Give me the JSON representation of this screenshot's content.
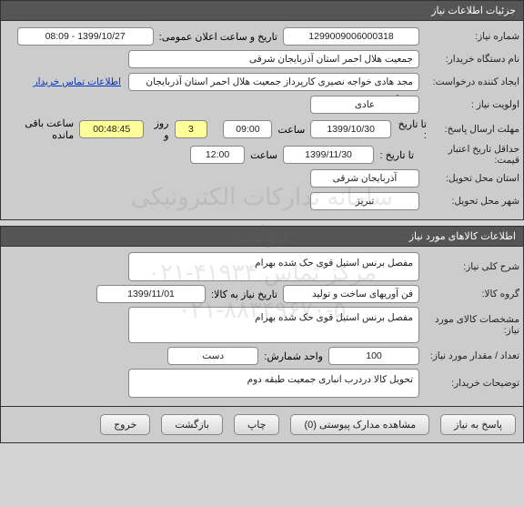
{
  "sections": {
    "need_info_header": "جزئیات اطلاعات نیاز",
    "goods_info_header": "اطلاعات کالاهای مورد نیاز"
  },
  "need": {
    "number_label": "شماره نیاز:",
    "number": "1299009006000318",
    "announce_label": "تاریخ و ساعت اعلان عمومی:",
    "announce_value": "1399/10/27 - 08:09",
    "buyer_label": "نام دستگاه خریدار:",
    "buyer": "جمعیت هلال احمر استان آذربایجان شرقی",
    "creator_label": "ایجاد کننده درخواست:",
    "creator": "مجد هادی خواجه نصیری کارپرداز جمعیت هلال احمر استان آذربایجان شرقی",
    "contact_link": "اطلاعات تماس خریدار",
    "priority_label": "اولویت نیاز :",
    "priority": "عادی",
    "deadline_label": "مهلت ارسال پاسخ:",
    "to_date_label": "تا تاریخ :",
    "to_date": "1399/10/30",
    "time_label": "ساعت",
    "to_time": "09:00",
    "days_value": "3",
    "days_unit": "روز و",
    "remain_time": "00:48:45",
    "remain_label": "ساعت باقی مانده",
    "validity_label": "حداقل تاریخ اعتبار قیمت:",
    "validity_to_label": "تا تاریخ :",
    "validity_date": "1399/11/30",
    "validity_time": "12:00",
    "province_label": "استان محل تحویل:",
    "province": "آذربایجان شرقی",
    "city_label": "شهر محل تحویل:",
    "city": "تبریز"
  },
  "goods": {
    "desc_label": "شرح کلی نیاز:",
    "desc": "مفصل برنس استیل قوی حک شده بهرام",
    "group_label": "گروه کالا:",
    "group": "فن آوریهای ساخت و تولید",
    "need_by_label": "تاریخ نیاز به کالا:",
    "need_by": "1399/11/01",
    "spec_label": "مشخصات کالای مورد نیاز:",
    "spec": "مفصل برنس استیل قوی حک شده بهرام",
    "qty_label": "تعداد / مقدار مورد نیاز:",
    "qty": "100",
    "unit_label": "واحد شمارش:",
    "unit": "دست",
    "notes_label": "توضیحات خریدار:",
    "notes": "تحویل کالا دردرب انباری جمعیت طبقه دوم"
  },
  "buttons": {
    "respond": "پاسخ به نیاز",
    "attachments": "مشاهده مدارک پیوستی (0)",
    "print": "چاپ",
    "back": "بازگشت",
    "exit": "خروج"
  },
  "watermark": {
    "line1": "سامانه تدارکات الکترونیکی دولت",
    "line2": "مرکز تماس ۴۱۹۳۴-۰۲۱",
    "line3": "۰۲۱-۸۸۳۴۹۶۷۰-۵"
  }
}
